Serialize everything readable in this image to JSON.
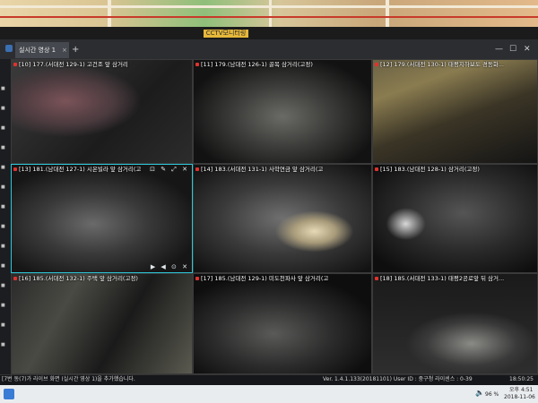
{
  "wall_label": "CCTV모니터링",
  "window": {
    "tab_label": "실시간 영상 1",
    "tab_close": "×",
    "new_tab": "+",
    "controls": [
      "—",
      "☐",
      "✕"
    ]
  },
  "sidebar": {
    "items": [
      "■",
      "■",
      "■",
      "■",
      "■",
      "■",
      "■",
      "■",
      "■",
      "■",
      "■",
      "■",
      "■",
      "■"
    ]
  },
  "cameras": [
    {
      "label": "[10] 177.(서대전 129-1) 고건조 앞 삼거리",
      "selected": false
    },
    {
      "label": "[11] 179.(남대전 126-1) 골목 삼거리(고정)",
      "selected": false
    },
    {
      "label": "[12] 179.(서대전 130-1) 태평지하보도 경동화...",
      "selected": false
    },
    {
      "label": "[13] 181.(남대전 127-1) 시온빌라 앞 삼거리(고",
      "selected": true
    },
    {
      "label": "[14] 183.(서대전 131-1) 사학연금 앞 삼거리(고",
      "selected": false
    },
    {
      "label": "[15] 183.(남대전 128-1) 삼거리(고정)",
      "selected": false
    },
    {
      "label": "[16] 185.(서대전 132-1) 주택 앞 삼거리(고정)",
      "selected": false
    },
    {
      "label": "[17] 185.(남대전 129-1) 미도천파사 앞 삼거리(고",
      "selected": false
    },
    {
      "label": "[18] 185.(서대전 133-1) 태평2공로앞 뒤 삼거...",
      "selected": false
    }
  ],
  "tile_toolbar": "⊡ ✎ ⤢ ✕",
  "tile_toolbar_bottom": "▶ ◀ ⊙ ✕",
  "status": {
    "message": "[7번 동(7)가 라이브 화면 (실시간 영상 1)을 추가했습니다.",
    "version": "Ver. 1.4.1.133(20181101)",
    "user": "User ID : 중구청",
    "license": "라이센스 : 0-39"
  },
  "taskbar": {
    "volume": "96 %",
    "time": "오후 4:51",
    "date": "2018-11-06",
    "clock_right": "18:50:25"
  },
  "colors": {
    "selected_border": "#2cc7d8",
    "rec_indicator": "#e0322e",
    "wall_label_bg": "#e6b83a"
  }
}
